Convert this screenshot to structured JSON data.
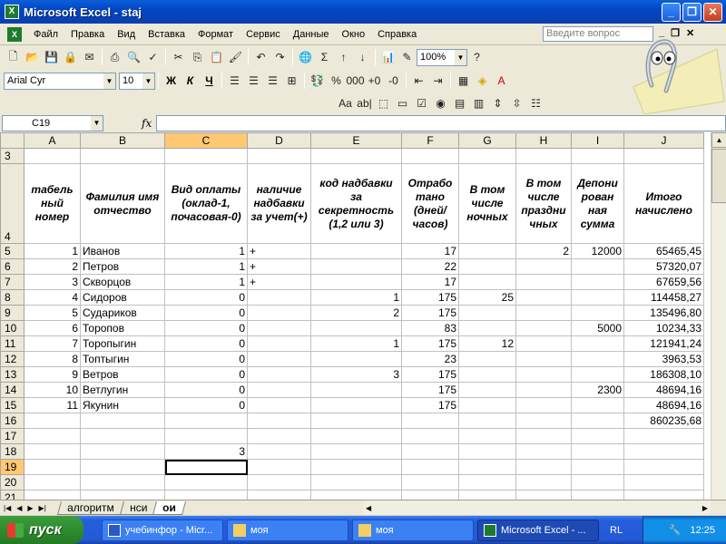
{
  "window": {
    "title": "Microsoft Excel - staj",
    "min": "_",
    "max": "❐",
    "close": "✕"
  },
  "menu": {
    "items": [
      "Файл",
      "Правка",
      "Вид",
      "Вставка",
      "Формат",
      "Сервис",
      "Данные",
      "Окно",
      "Справка"
    ],
    "help_placeholder": "Введите вопрос"
  },
  "toolbar": {
    "zoom": "100%",
    "font": "Arial Cyr",
    "size": "10",
    "bold": "Ж",
    "italic": "К",
    "underline": "Ч"
  },
  "formula_bar": {
    "name_box": "C19",
    "fx": "fx",
    "value": ""
  },
  "grid": {
    "columns": [
      "A",
      "B",
      "C",
      "D",
      "E",
      "F",
      "G",
      "H",
      "I",
      "J"
    ],
    "header_row": {
      "num": "4",
      "cells": [
        "табель ный номер",
        "Фамилия имя отчество",
        "Вид оплаты (оклад-1, почасовая-0)",
        "наличие надбавки за учет(+)",
        "код надбавки за секретность (1,2 или 3)",
        "Отрабо тано (дней/ часов)",
        "В том числе ночных",
        "В том числе праздни чных",
        "Депони рован ная сумма",
        "Итого начислено"
      ]
    },
    "rows": [
      {
        "num": "3",
        "c": [
          "",
          "",
          "",
          "",
          "",
          "",
          "",
          "",
          "",
          ""
        ]
      },
      {
        "num": "5",
        "c": [
          "1",
          "Иванов",
          "1",
          "+",
          "",
          "17",
          "",
          "2",
          "12000",
          "65465,45"
        ]
      },
      {
        "num": "6",
        "c": [
          "2",
          "Петров",
          "1",
          "+",
          "",
          "22",
          "",
          "",
          "",
          "57320,07"
        ]
      },
      {
        "num": "7",
        "c": [
          "3",
          "Скворцов",
          "1",
          "+",
          "",
          "17",
          "",
          "",
          "",
          "67659,56"
        ]
      },
      {
        "num": "8",
        "c": [
          "4",
          "Сидоров",
          "0",
          "",
          "1",
          "175",
          "25",
          "",
          "",
          "114458,27"
        ]
      },
      {
        "num": "9",
        "c": [
          "5",
          "Судариков",
          "0",
          "",
          "2",
          "175",
          "",
          "",
          "",
          "135496,80"
        ]
      },
      {
        "num": "10",
        "c": [
          "6",
          "Торопов",
          "0",
          "",
          "",
          "83",
          "",
          "",
          "5000",
          "10234,33"
        ]
      },
      {
        "num": "11",
        "c": [
          "7",
          "Торопыгин",
          "0",
          "",
          "1",
          "175",
          "12",
          "",
          "",
          "121941,24"
        ]
      },
      {
        "num": "12",
        "c": [
          "8",
          "Топтыгин",
          "0",
          "",
          "",
          "23",
          "",
          "",
          "",
          "3963,53"
        ]
      },
      {
        "num": "13",
        "c": [
          "9",
          "Ветров",
          "0",
          "",
          "3",
          "175",
          "",
          "",
          "",
          "186308,10"
        ]
      },
      {
        "num": "14",
        "c": [
          "10",
          "Ветлугин",
          "0",
          "",
          "",
          "175",
          "",
          "",
          "2300",
          "48694,16"
        ]
      },
      {
        "num": "15",
        "c": [
          "11",
          "Якунин",
          "0",
          "",
          "",
          "175",
          "",
          "",
          "",
          "48694,16"
        ]
      },
      {
        "num": "16",
        "c": [
          "",
          "",
          "",
          "",
          "",
          "",
          "",
          "",
          "",
          "860235,68"
        ]
      },
      {
        "num": "17",
        "c": [
          "",
          "",
          "",
          "",
          "",
          "",
          "",
          "",
          "",
          ""
        ]
      },
      {
        "num": "18",
        "c": [
          "",
          "",
          "3",
          "",
          "",
          "",
          "",
          "",
          "",
          ""
        ]
      },
      {
        "num": "19",
        "c": [
          "",
          "",
          "",
          "",
          "",
          "",
          "",
          "",
          "",
          ""
        ]
      },
      {
        "num": "20",
        "c": [
          "",
          "",
          "",
          "",
          "",
          "",
          "",
          "",
          "",
          ""
        ]
      },
      {
        "num": "21",
        "c": [
          "",
          "",
          "",
          "",
          "",
          "",
          "",
          "",
          "",
          ""
        ]
      }
    ]
  },
  "sheets": [
    "алгоритм",
    "нси",
    "ои"
  ],
  "active_sheet": "ои",
  "taskbar": {
    "start": "пуск",
    "tasks": [
      "учебинфор - Micr...",
      "моя",
      "моя",
      "Microsoft Excel - ..."
    ],
    "lang": "RL",
    "clock": "12:25"
  }
}
